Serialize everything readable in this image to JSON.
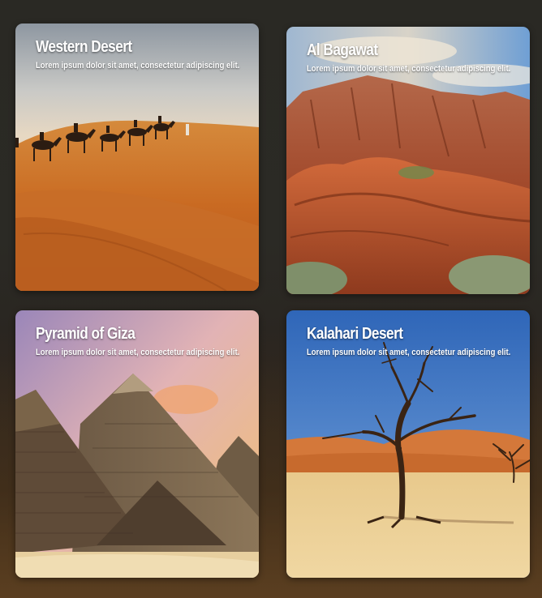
{
  "cards": [
    {
      "title": "Western Desert",
      "description": "Lorem ipsum dolor sit amet, consectetur adipiscing elit.",
      "image": "camel-caravan-dunes"
    },
    {
      "title": "Al Bagawat",
      "description": "Lorem ipsum dolor sit amet, consectetur adipiscing elit.",
      "image": "red-rock-formation"
    },
    {
      "title": "Pyramid of Giza",
      "description": "Lorem ipsum dolor sit amet, consectetur adipiscing elit.",
      "image": "giza-pyramids"
    },
    {
      "title": "Kalahari Desert",
      "description": "Lorem ipsum dolor sit amet, consectetur adipiscing elit.",
      "image": "dead-tree-desert"
    }
  ],
  "colors": {
    "page_background": "#2a2924",
    "sand": "#d5782a",
    "sky_blue": "#3f7fcf",
    "caption_text": "#ffffff"
  }
}
